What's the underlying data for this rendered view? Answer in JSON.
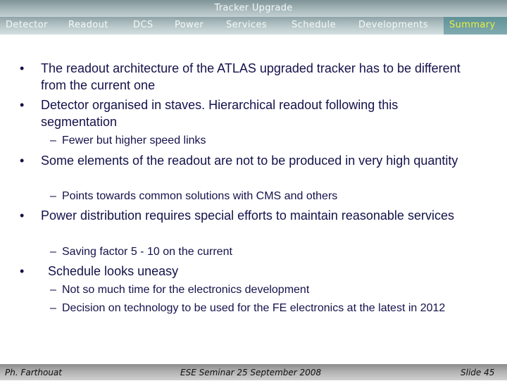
{
  "header": {
    "title": "Tracker Upgrade"
  },
  "nav": {
    "items": [
      {
        "label": "Detector",
        "active": false
      },
      {
        "label": "Readout",
        "active": false
      },
      {
        "label": "DCS",
        "active": false
      },
      {
        "label": "Power",
        "active": false
      },
      {
        "label": "Services",
        "active": false
      },
      {
        "label": "Schedule",
        "active": false
      },
      {
        "label": "Developments",
        "active": false
      },
      {
        "label": "Summary",
        "active": true
      }
    ],
    "active_color": "#e8f23a"
  },
  "content": {
    "bullet_glyph": "•",
    "dash_glyph": "–",
    "bullets": [
      {
        "text": "The readout architecture of the ATLAS upgraded tracker has to be different from the current one"
      },
      {
        "text": "Detector organised in staves. Hierarchical readout following this segmentation",
        "subs": [
          "Fewer but higher speed links"
        ]
      },
      {
        "text": "Some elements of the readout are not to be produced in very high quantity",
        "subs": [
          "Points towards common solutions with CMS and others"
        ]
      },
      {
        "text": "Power distribution requires special efforts to maintain reasonable services",
        "subs": [
          "Saving factor 5 - 10 on the current"
        ]
      },
      {
        "text": "Schedule looks uneasy",
        "subs": [
          "Not so much time for the electronics development",
          "Decision on technology to be used for the FE electronics at the latest in 2012"
        ]
      }
    ]
  },
  "footer": {
    "author": "Ph. Farthouat",
    "event": "ESE Seminar 25 September 2008",
    "slide": "Slide 45"
  }
}
